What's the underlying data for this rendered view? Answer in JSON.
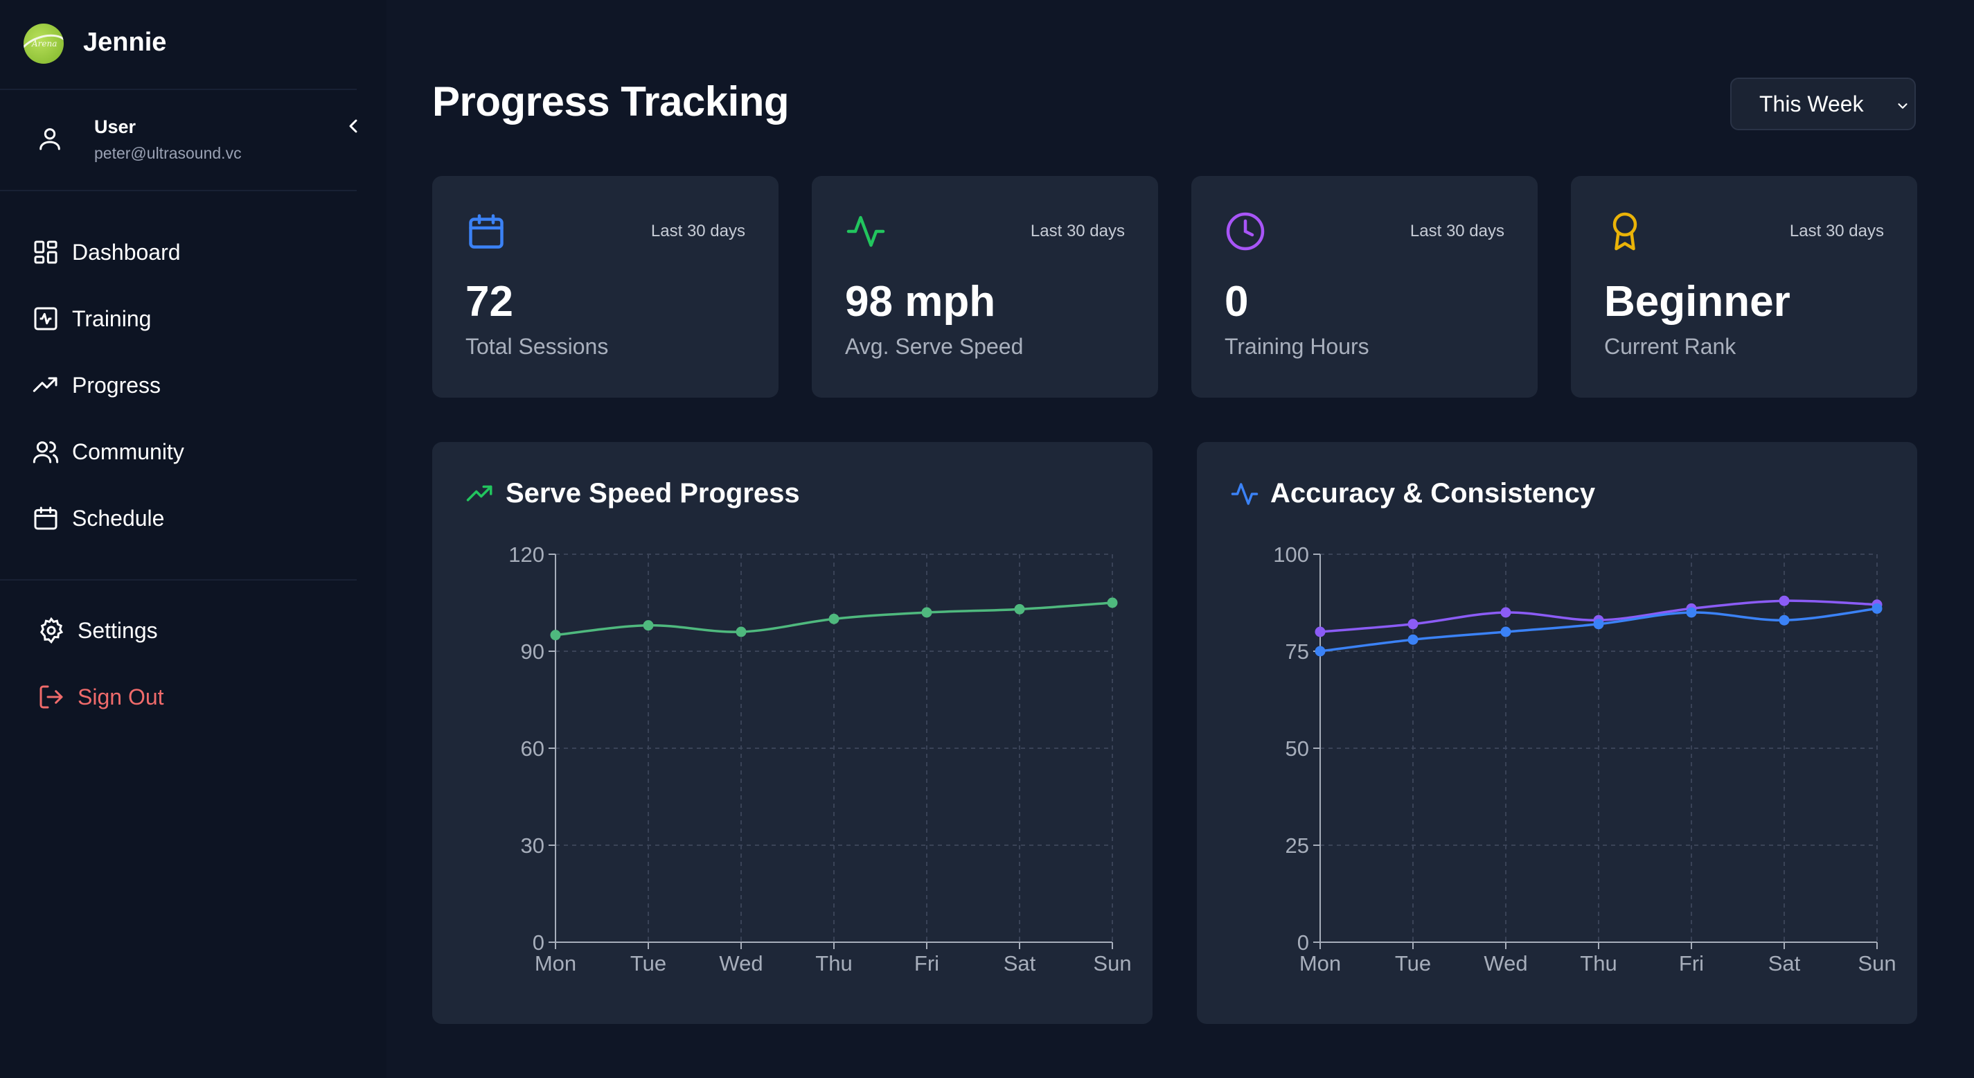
{
  "app": {
    "brand": "Jennie",
    "logo_text": "Arena"
  },
  "user": {
    "name": "User",
    "email": "peter@ultrasound.vc"
  },
  "nav": {
    "dashboard": "Dashboard",
    "training": "Training",
    "progress": "Progress",
    "community": "Community",
    "schedule": "Schedule",
    "settings": "Settings",
    "signout": "Sign Out"
  },
  "page": {
    "title": "Progress Tracking",
    "period_select": "This Week"
  },
  "stats": [
    {
      "value": "72",
      "label": "Total Sessions",
      "period": "Last 30 days",
      "icon": "calendar-icon",
      "color": "#3b82f6"
    },
    {
      "value": "98 mph",
      "label": "Avg. Serve Speed",
      "period": "Last 30 days",
      "icon": "activity-icon",
      "color": "#22c55e"
    },
    {
      "value": "0",
      "label": "Training Hours",
      "period": "Last 30 days",
      "icon": "clock-icon",
      "color": "#a855f7"
    },
    {
      "value": "Beginner",
      "label": "Current Rank",
      "period": "Last 30 days",
      "icon": "award-icon",
      "color": "#eab308"
    }
  ],
  "chart_data": [
    {
      "type": "line",
      "title": "Serve Speed Progress",
      "categories": [
        "Mon",
        "Tue",
        "Wed",
        "Thu",
        "Fri",
        "Sat",
        "Sun"
      ],
      "series": [
        {
          "values": [
            95,
            98,
            96,
            100,
            102,
            103,
            105
          ],
          "color": "#4fb97e"
        }
      ],
      "ylim": [
        0,
        120
      ],
      "yticks": [
        0,
        30,
        60,
        90,
        120
      ],
      "grid": true
    },
    {
      "type": "line",
      "title": "Accuracy & Consistency",
      "categories": [
        "Mon",
        "Tue",
        "Wed",
        "Thu",
        "Fri",
        "Sat",
        "Sun"
      ],
      "series": [
        {
          "values": [
            80,
            82,
            85,
            83,
            86,
            88,
            87
          ],
          "color": "#8b5cf6"
        },
        {
          "values": [
            75,
            78,
            80,
            82,
            85,
            83,
            86
          ],
          "color": "#3b82f6"
        }
      ],
      "ylim": [
        0,
        100
      ],
      "yticks": [
        0,
        25,
        50,
        75,
        100
      ],
      "grid": true
    }
  ]
}
